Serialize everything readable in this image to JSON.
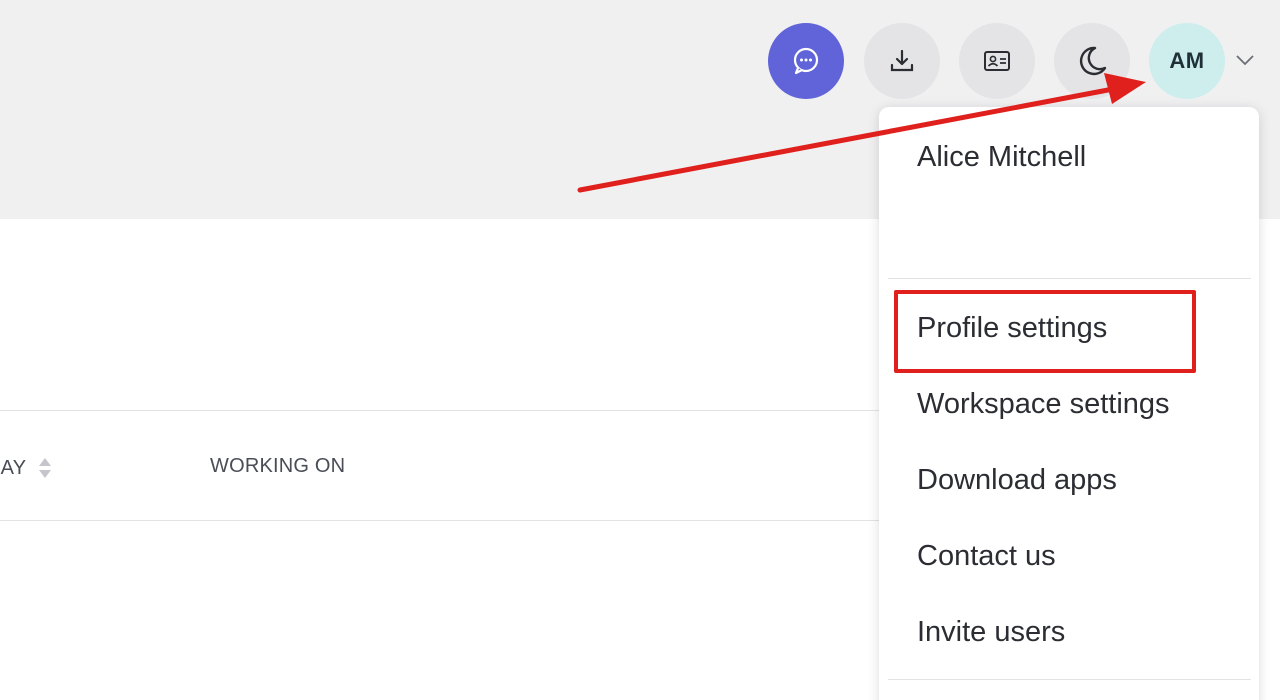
{
  "header": {
    "buttons": [
      {
        "name": "chat",
        "icon": "chat-bubble-icon",
        "color": "#6164d8"
      },
      {
        "name": "download",
        "icon": "download-icon"
      },
      {
        "name": "contact-card",
        "icon": "id-card-icon"
      },
      {
        "name": "dark-mode",
        "icon": "moon-icon"
      }
    ],
    "avatar_initials": "AM",
    "avatar_color": "#cdeeed",
    "chevron_icon": "chevron-down-icon"
  },
  "table": {
    "columns": [
      {
        "label": "DAY",
        "sortable": true
      },
      {
        "label": "WORKING ON",
        "sortable": false
      }
    ]
  },
  "dropdown": {
    "user_name": "Alice Mitchell",
    "items": [
      {
        "label": "Profile settings",
        "highlighted": true
      },
      {
        "label": "Workspace settings"
      },
      {
        "label": "Download apps"
      },
      {
        "label": "Contact us"
      },
      {
        "label": "Invite users"
      }
    ]
  },
  "annotations": {
    "color": "#e0201d",
    "arrow_target": "avatar",
    "highlight_target": "Profile settings"
  }
}
